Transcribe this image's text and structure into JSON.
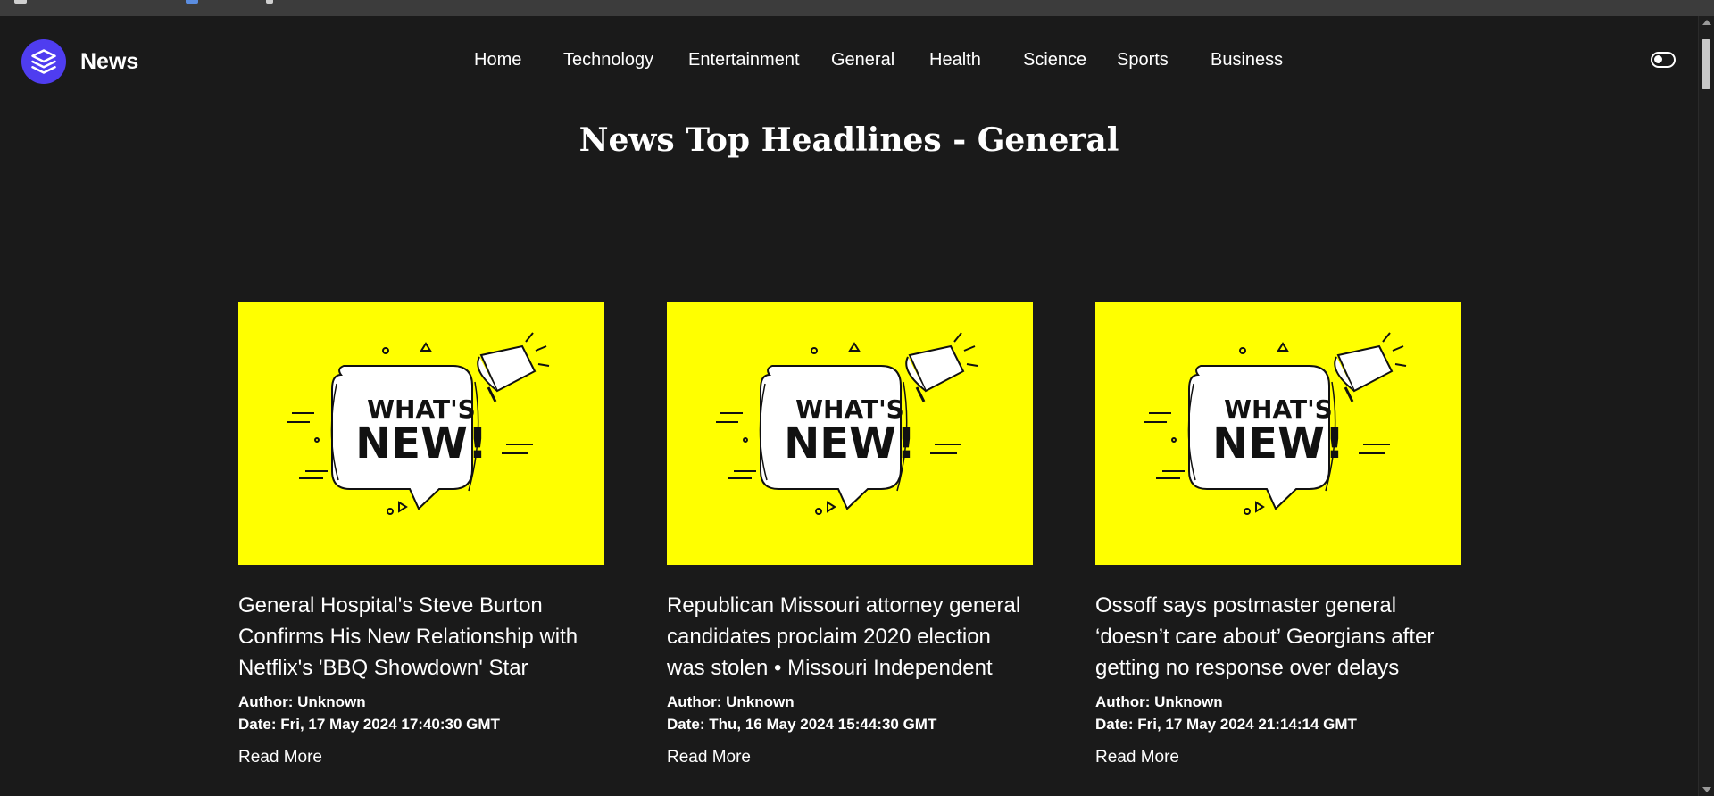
{
  "brand": {
    "name": "News",
    "icon": "layers-icon",
    "accent": "#4f3df0"
  },
  "nav": {
    "items": [
      {
        "label": "Home"
      },
      {
        "label": "Technology"
      },
      {
        "label": "Entertainment"
      },
      {
        "label": "General"
      },
      {
        "label": "Health"
      },
      {
        "label": "Science"
      },
      {
        "label": "Sports"
      },
      {
        "label": "Business"
      }
    ],
    "theme_toggle_icon": "toggle-switch-icon"
  },
  "page": {
    "title": "News Top Headlines - General"
  },
  "image": {
    "line1": "WHAT'S",
    "line2": "NEW!",
    "background": "#ffff00"
  },
  "articles": [
    {
      "title": "General Hospital's Steve Burton Confirms His New Relationship with Netflix's 'BBQ Showdown' Star",
      "author": "Author: Unknown",
      "date": "Date: Fri, 17 May 2024 17:40:30 GMT",
      "read_more": "Read More"
    },
    {
      "title": "Republican Missouri attorney general candidates proclaim 2020 election was stolen • Missouri Independent",
      "author": "Author: Unknown",
      "date": "Date: Thu, 16 May 2024 15:44:30 GMT",
      "read_more": "Read More"
    },
    {
      "title": "Ossoff says postmaster general ‘doesn’t care about’ Georgians after getting no response over delays",
      "author": "Author: Unknown",
      "date": "Date: Fri, 17 May 2024 21:14:14 GMT",
      "read_more": "Read More"
    }
  ]
}
